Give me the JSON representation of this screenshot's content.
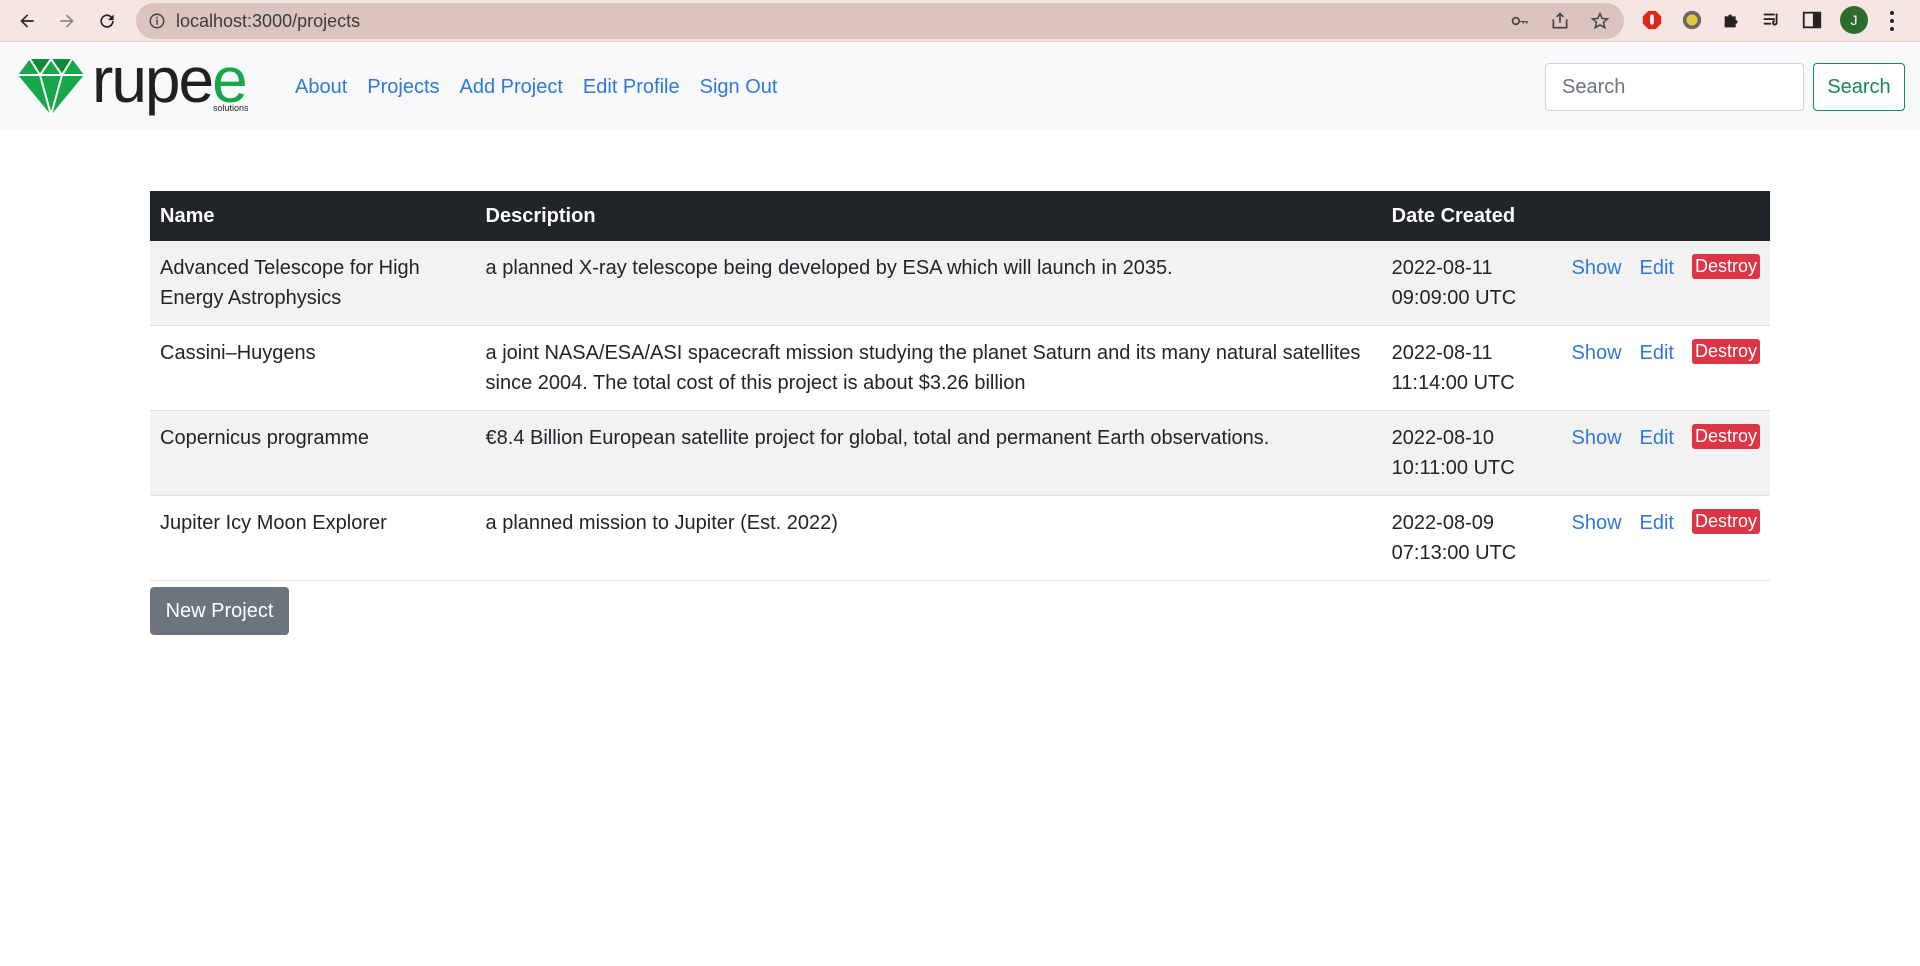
{
  "browser": {
    "url": "localhost:3000/projects",
    "avatar_initial": "J"
  },
  "brand": {
    "word_main": "rupe",
    "word_accent": "e",
    "subtitle": "solutions",
    "accent_color": "#17a84b"
  },
  "nav": {
    "links": [
      "About",
      "Projects",
      "Add Project",
      "Edit Profile",
      "Sign Out"
    ]
  },
  "search": {
    "placeholder": "Search",
    "button_label": "Search"
  },
  "table": {
    "headers": [
      "Name",
      "Description",
      "Date Created"
    ],
    "rows": [
      {
        "name": "Advanced Telescope for High Energy Astrophysics",
        "description": "a planned X-ray telescope being developed by ESA which will launch in 2035.",
        "date_line1": "2022-08-11",
        "date_line2": "09:09:00 UTC"
      },
      {
        "name": "Cassini–Huygens",
        "description": "a joint NASA/ESA/ASI spacecraft mission studying the planet Saturn and its many natural satellites since 2004. The total cost of this project is about $3.26 billion",
        "date_line1": "2022-08-11",
        "date_line2": "11:14:00 UTC"
      },
      {
        "name": "Copernicus programme",
        "description": "€8.4 Billion European satellite project for global, total and permanent Earth observations.",
        "date_line1": "2022-08-10",
        "date_line2": "10:11:00 UTC"
      },
      {
        "name": "Jupiter Icy Moon Explorer",
        "description": "a planned mission to Jupiter (Est. 2022)",
        "date_line1": "2022-08-09",
        "date_line2": "07:13:00 UTC"
      }
    ],
    "actions": {
      "show": "Show",
      "edit": "Edit",
      "destroy": "Destroy"
    }
  },
  "new_project_label": "New Project"
}
